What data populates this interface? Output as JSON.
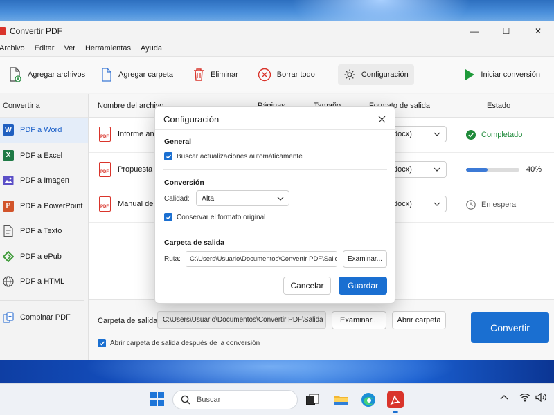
{
  "window": {
    "title": "Convertir PDF",
    "controls": {
      "minimize": "—",
      "maximize": "☐",
      "close": "✕"
    }
  },
  "menu": [
    "Archivo",
    "Editar",
    "Ver",
    "Herramientas",
    "Ayuda"
  ],
  "toolbar": {
    "add_files": "Agregar archivos",
    "add_folder": "Agregar carpeta",
    "delete": "Eliminar",
    "clear_all": "Borrar todo",
    "settings": "Configuración",
    "start": "Iniciar conversión"
  },
  "sidebar": {
    "title": "Convertir a",
    "items": [
      {
        "label": "PDF a Word",
        "icon": "word-icon",
        "badge": "W",
        "color": "#1f5fc0"
      },
      {
        "label": "PDF a Excel",
        "icon": "excel-icon",
        "badge": "X",
        "color": "#1f7a45"
      },
      {
        "label": "PDF a Imagen",
        "icon": "image-icon",
        "badge": "",
        "color": "#5b4fc7"
      },
      {
        "label": "PDF a PowerPoint",
        "icon": "powerpoint-icon",
        "badge": "P",
        "color": "#d2542a"
      },
      {
        "label": "PDF a Texto",
        "icon": "text-file-icon",
        "badge": "",
        "color": "#555555"
      },
      {
        "label": "PDF a ePub",
        "icon": "epub-icon",
        "badge": "",
        "color": "#3f9b3a"
      },
      {
        "label": "PDF a HTML",
        "icon": "globe-icon",
        "badge": "",
        "color": "#444444"
      }
    ],
    "combine": "Combinar PDF"
  },
  "table": {
    "columns": [
      "Nombre del archivo",
      "Páginas",
      "Tamaño",
      "Formato de salida",
      "Estado"
    ],
    "rows": [
      {
        "name": "Informe anu",
        "format": "docx)",
        "status": "Completado"
      },
      {
        "name": "Propuesta d",
        "format": "docx)",
        "progress_text": "40%",
        "progress": 0.4
      },
      {
        "name": "Manual de u",
        "format": "docx)",
        "status": "En espera"
      }
    ]
  },
  "output": {
    "label": "Carpeta de salida:",
    "path": "C:\\Users\\Usuario\\Documentos\\Convertir PDF\\Salida",
    "browse": "Examinar...",
    "open_folder": "Abrir carpeta",
    "open_after": "Abrir carpeta de salida después de la conversión",
    "convert": "Convertir"
  },
  "dialog": {
    "title": "Configuración",
    "general_title": "General",
    "auto_update": "Buscar actualizaciones automáticamente",
    "conversion_title": "Conversión",
    "quality_label": "Calidad:",
    "quality_value": "Alta",
    "keep_format": "Conservar el formato original",
    "output_title": "Carpeta de salida",
    "path_label": "Ruta:",
    "path_value": "C:\\Users\\Usuario\\Documentos\\Convertir PDF\\Salida",
    "browse": "Examinar...",
    "cancel": "Cancelar",
    "save": "Guardar"
  },
  "taskbar": {
    "search_placeholder": "Buscar"
  },
  "colors": {
    "accent": "#1a6fd1",
    "pdf_red": "#d9342b",
    "success": "#1f8a3a"
  }
}
